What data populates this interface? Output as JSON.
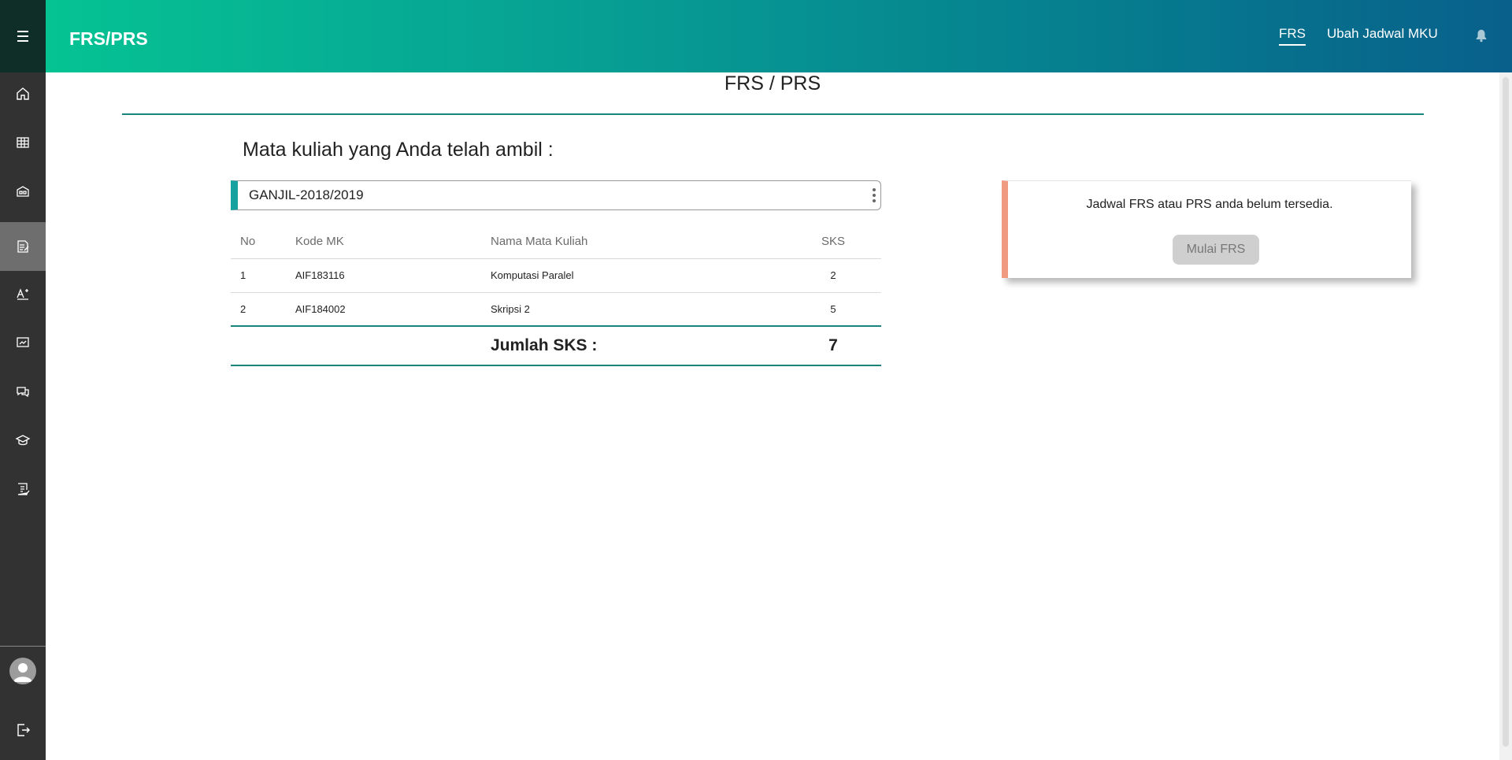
{
  "header": {
    "app_title": "FRS/PRS",
    "nav_links": [
      {
        "label": "FRS",
        "active": true
      },
      {
        "label": "Ubah Jadwal MKU",
        "active": false
      }
    ]
  },
  "sidebar": {
    "items": [
      {
        "icon": "home-icon"
      },
      {
        "icon": "table-icon"
      },
      {
        "icon": "building-icon"
      },
      {
        "icon": "document-edit-icon",
        "active": true
      },
      {
        "icon": "text-plus-icon"
      },
      {
        "icon": "presentation-icon"
      },
      {
        "icon": "chat-icon"
      },
      {
        "icon": "graduation-cap-icon"
      },
      {
        "icon": "checklist-icon"
      }
    ],
    "bottom": [
      {
        "icon": "user-avatar"
      },
      {
        "icon": "logout-icon"
      }
    ]
  },
  "main": {
    "page_title": "FRS / PRS",
    "section_heading": "Mata kuliah yang Anda telah ambil :",
    "semester_select": "GANJIL-2018/2019",
    "table": {
      "headers": [
        "No",
        "Kode MK",
        "Nama Mata Kuliah",
        "SKS"
      ],
      "rows": [
        {
          "no": "1",
          "kode": "AIF183116",
          "nama": "Komputasi Paralel",
          "sks": "2"
        },
        {
          "no": "2",
          "kode": "AIF184002",
          "nama": "Skripsi 2",
          "sks": "5"
        }
      ],
      "total_label": "Jumlah SKS :",
      "total_value": "7"
    }
  },
  "notice": {
    "message": "Jadwal FRS atau PRS anda belum tersedia.",
    "button_label": "Mulai FRS"
  },
  "colors": {
    "accent": "#17857c",
    "notice_border": "#f09a82",
    "sidebar_bg": "#323232"
  }
}
